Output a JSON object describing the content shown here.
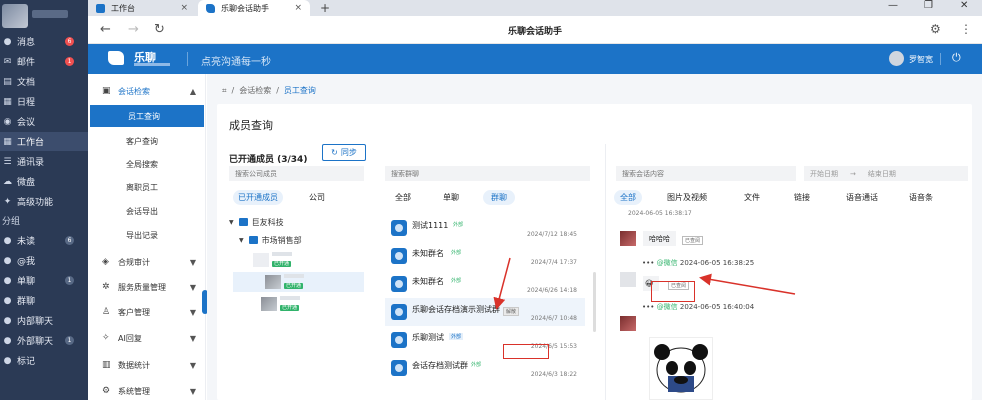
{
  "leftnav": {
    "items": [
      {
        "label": "消息",
        "icon": "chat-bubble-icon",
        "badge": "6",
        "badge_type": "red"
      },
      {
        "label": "邮件",
        "icon": "mail-icon",
        "badge": "1",
        "badge_type": "red"
      },
      {
        "label": "文档",
        "icon": "document-icon"
      },
      {
        "label": "日程",
        "icon": "calendar-icon"
      },
      {
        "label": "会议",
        "icon": "meeting-icon"
      },
      {
        "label": "工作台",
        "icon": "grid-icon",
        "active": true
      },
      {
        "label": "通讯录",
        "icon": "contacts-icon"
      },
      {
        "label": "微盘",
        "icon": "cloud-drive-icon"
      },
      {
        "label": "高级功能",
        "icon": "star-icon"
      }
    ],
    "section_label": "分组",
    "groups": [
      {
        "label": "未读",
        "badge": "6"
      },
      {
        "label": "@我"
      },
      {
        "label": "单聊",
        "badge": "1"
      },
      {
        "label": "群聊"
      },
      {
        "label": "内部聊天"
      },
      {
        "label": "外部聊天",
        "badge": "1"
      },
      {
        "label": "标记"
      }
    ]
  },
  "browser": {
    "tabs": [
      {
        "label": "工作台",
        "active": false
      },
      {
        "label": "乐聊会话助手",
        "active": true
      }
    ],
    "title": "乐聊会话助手"
  },
  "header": {
    "brand": "乐聊",
    "slogan": "点亮沟通每一秒",
    "user_name": "罗智宽"
  },
  "sidemenu": {
    "sections": [
      {
        "label": "会话检索",
        "icon": "chat-search-icon",
        "open": true,
        "children": [
          "员工查询",
          "客户查询",
          "全局搜索",
          "离职员工",
          "会话导出",
          "导出记录"
        ]
      },
      {
        "label": "合规审计",
        "icon": "shield-icon"
      },
      {
        "label": "服务质量管理",
        "icon": "settings-icon"
      },
      {
        "label": "客户管理",
        "icon": "person-icon"
      },
      {
        "label": "AI回复",
        "icon": "ai-icon"
      },
      {
        "label": "数据统计",
        "icon": "chart-icon"
      },
      {
        "label": "系统管理",
        "icon": "gear-icon"
      }
    ]
  },
  "breadcrumb": {
    "home_icon": "home-icon",
    "parent": "会话检索",
    "current": "员工查询"
  },
  "page_title": "成员查询",
  "members": {
    "count_label": "已开通成员 (3/34)",
    "sync_label": "同步",
    "search_placeholder": "搜索公司成员",
    "tabs": [
      "已开通成员",
      "公司"
    ],
    "tree": {
      "company": "巨友科技",
      "dept": "市场销售部"
    },
    "tag": "已开通"
  },
  "chats": {
    "search_placeholder": "搜索群聊",
    "tabs": [
      "全部",
      "单聊",
      "群聊"
    ],
    "active_tab": "群聊",
    "list": [
      {
        "name": "测试1111",
        "tag": "外部",
        "date": "2024/7/12 18:45"
      },
      {
        "name": "未知群名",
        "tag": "外部",
        "date": "2024/7/4 17:37"
      },
      {
        "name": "未知群名",
        "tag": "外部",
        "date": "2024/6/26 14:18"
      },
      {
        "name": "乐聊会话存档演示测试群",
        "tag": "",
        "disabled": "解散",
        "date": "2024/6/7 10:48",
        "selected": true
      },
      {
        "name": "乐聊测试",
        "tag": "外部",
        "tag_style": "blue",
        "date": "2024/6/5 15:53"
      },
      {
        "name": "会话存档测试群",
        "tag": "外部",
        "date": "2024/6/3 18:22"
      }
    ]
  },
  "messages": {
    "search_placeholder": "搜索会话内容",
    "start_date": "开始日期",
    "end_date": "结束日期",
    "tabs": [
      "全部",
      "图片及视频",
      "文件",
      "链接",
      "语音通话",
      "语音条"
    ],
    "active_tab": "全部",
    "top_time": "2024-06-05 16:38:17",
    "items": [
      {
        "text": "哈哈哈",
        "read": "已查阅"
      },
      {
        "sender_suffix": "@微信",
        "time": "2024-06-05 16:38:25",
        "emoji": "😀",
        "read": "已查阅"
      },
      {
        "sender_suffix": "@微信",
        "time": "2024-06-05 16:40:04"
      }
    ]
  },
  "colors": {
    "accent": "#1c73c7",
    "nav_bg": "#2b3a55",
    "annotation_red": "#d9322a",
    "external_green": "#31b36b"
  }
}
